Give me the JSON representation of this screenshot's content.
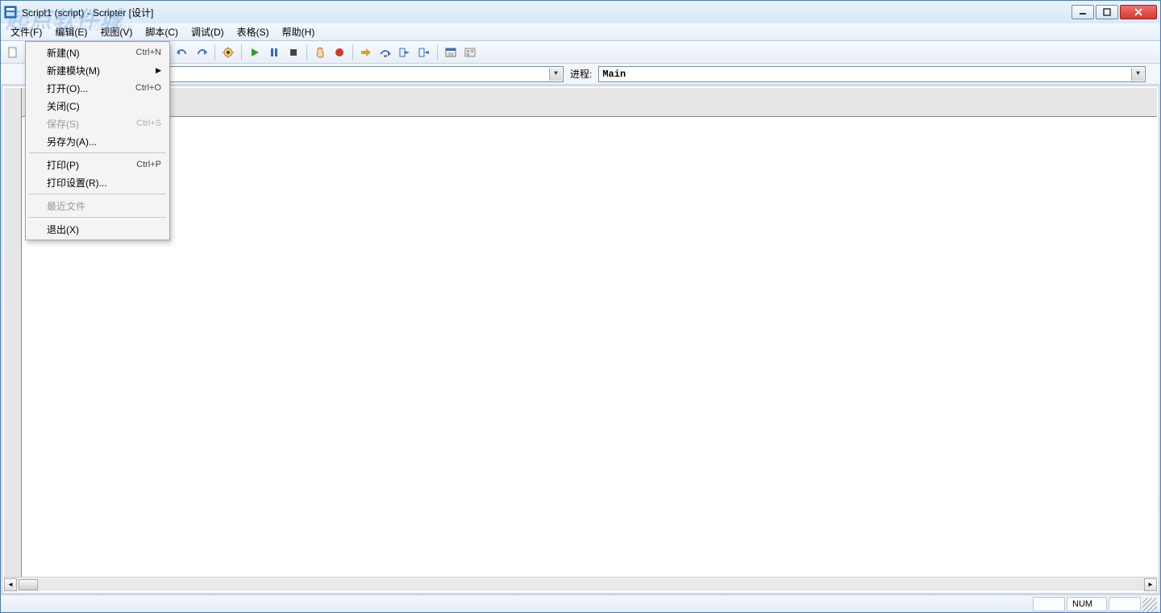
{
  "window": {
    "title": "Script1 (script) - Scripter [设计]"
  },
  "menubar": {
    "items": [
      "文件(F)",
      "编辑(E)",
      "视图(V)",
      "脚本(C)",
      "调试(D)",
      "表格(S)",
      "帮助(H)"
    ]
  },
  "file_menu": {
    "new": {
      "label": "新建(N)",
      "shortcut": "Ctrl+N"
    },
    "new_module": {
      "label": "新建模块(M)"
    },
    "open": {
      "label": "打开(O)...",
      "shortcut": "Ctrl+O"
    },
    "close": {
      "label": "关闭(C)"
    },
    "save": {
      "label": "保存(S)",
      "shortcut": "Ctrl+S"
    },
    "saveas": {
      "label": "另存为(A)..."
    },
    "print": {
      "label": "打印(P)",
      "shortcut": "Ctrl+P"
    },
    "print_setup": {
      "label": "打印设置(R)..."
    },
    "recent": {
      "label": "最近文件"
    },
    "exit": {
      "label": "退出(X)"
    }
  },
  "combobar": {
    "process_label": "进程:",
    "process_value": "Main"
  },
  "status": {
    "num": "NUM"
  },
  "toolbar_icons": {
    "new": "new-file-icon",
    "open": "open-folder-icon",
    "save": "save-disk-icon",
    "print": "print-icon",
    "find": "find-icon",
    "cut": "cut-icon",
    "copy": "copy-icon",
    "paste": "paste-icon",
    "undo": "undo-icon",
    "redo": "redo-icon",
    "watch": "watch-icon",
    "play": "play-icon",
    "pause": "pause-icon",
    "stop": "stop-icon",
    "hand": "hand-icon",
    "brkpt": "breakpoint-icon",
    "step_into": "step-into-icon",
    "step_over": "step-over-icon",
    "step_out": "step-out-icon",
    "step_cursor": "step-cursor-icon",
    "form1": "dialog-icon",
    "form2": "toolbox-icon"
  },
  "watermark": {
    "main": "起点软件城",
    "url": "www.pc0359.cn"
  }
}
